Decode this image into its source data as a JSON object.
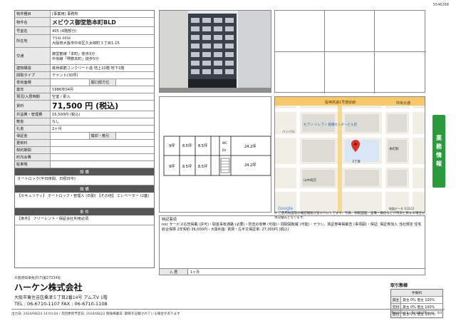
{
  "doc_id": "5546268",
  "spec": {
    "type_label": "物件種目",
    "type_value": "[事業用] 事務所",
    "name_label": "物件名",
    "name_value": "メビウス御堂筋本町BLD",
    "room_label": "号室名",
    "room_value": "405 (4階部分)",
    "addr_label": "所在地",
    "addr_zip": "〒541-0056",
    "addr_value": "大阪府大阪市中央区久太郎町３丁目1-15",
    "traffic_label": "交通",
    "traffic_1": "御堂筋線「本町」徒歩3分",
    "traffic_2": "中央線「堺筋本町」徒歩5分",
    "struct_label": "建物構造",
    "struct_value": "鉄骨鉄筋コンクリート造 地上10階 地下1階",
    "layout_label": "間取タイプ",
    "layout_value": "テナント(30坪)",
    "area_label": "専有面積",
    "dir_label": "開口部方位",
    "built_label": "築年",
    "built_value": "1986年04月",
    "move_label": "現況/入居時期",
    "move_value": "空室 / 即入",
    "rent_label": "賃料",
    "rent_value": "71,500 円 (税込)",
    "fee_label": "共益費・管理費",
    "fee_value": "16,500円 (税込)",
    "deposit_label": "敷金",
    "deposit_value": "なし",
    "key_label": "礼金",
    "key_value": "2ヶ月",
    "hoshokin_label": "保証金",
    "shokyaku_label": "償却・敷引",
    "renew_label": "更新料",
    "contract_label": "契約期間",
    "town_label": "町内会費",
    "park_label": "駐車場"
  },
  "sections": {
    "equip_head": "設 備",
    "equip_body": "オートロック(平日夜間、日祝日中)",
    "cond_head": "設 備",
    "cond_body": "【セキュリティ】 オートロック・管理人 (日勤) 【その他】 エレベーター (2基)",
    "terms_head": "条 件",
    "terms_body": "【条件】 フリーレント・保証会社利用必須"
  },
  "plan": {
    "rooms": [
      "9坪",
      "8.5坪",
      "8.5坪",
      "24.2坪",
      "9坪",
      "8.5坪",
      "8.5坪",
      "24.2坪"
    ],
    "wc": "WC",
    "ev": "EV"
  },
  "map": {
    "road_top": "阪神高速1号環状線",
    "road_right": "中央大通",
    "store": "セブン-イレブン 船場センタービル店",
    "place_1": "本町駅",
    "place_2": "3丁目",
    "place_3": "ハンバル",
    "place_4": "山中商店",
    "place_5": "Google",
    "credit": "地図データ ©2022",
    "caption": "※ ご使用地図等の確認機能が変わりにしてます。写真、間取図面、設備・構造などが現況と異なる場合は現況優先となります。"
  },
  "side_tab": [
    "業",
    "務",
    "情",
    "報"
  ],
  "notes": {
    "title": "特記事項",
    "body": "noc サービス広告掲載 (許可)・取扱事有通路 (必要)・防音の有無 (可能)・間取図転載 (可能)・ヤラシ、賃証券等掲載告 (事項図)・保証: 保証券加入 当社規定 住宅総合保険 2年契約 36,000円・大阪利金: 賃貸・左半文保証率: 27,000円 (税込)",
    "avail_label": "入 居",
    "avail_value": "1ヶ月"
  },
  "company": {
    "license": "大阪府知事免許(7)第27334号",
    "name": "ハーケン株式会社",
    "address": "大阪市東住吉区桑津５丁目2番14号 アムズV 1階",
    "tel": "TEL : 06-6710-1107 FAX : 06-6710-1108"
  },
  "trade": {
    "title": "取引態様",
    "header": "手数料",
    "row1_k": "貸主",
    "row1_v": "貸主 0% 借主 100%",
    "row2_k": "元付",
    "row2_v": "貸主 0% 借主 100%",
    "row3_k": "客付",
    "row3_v": "貸主 0% 借主 100%"
  },
  "footer": {
    "left": "出力日: 2024/08/24 14:03:04 / 次回更新予定日: 2024/08/22 情報掲載日: 期限を記載されている場合があります",
    "right": "Powered by RealNetPro co., ltd"
  }
}
